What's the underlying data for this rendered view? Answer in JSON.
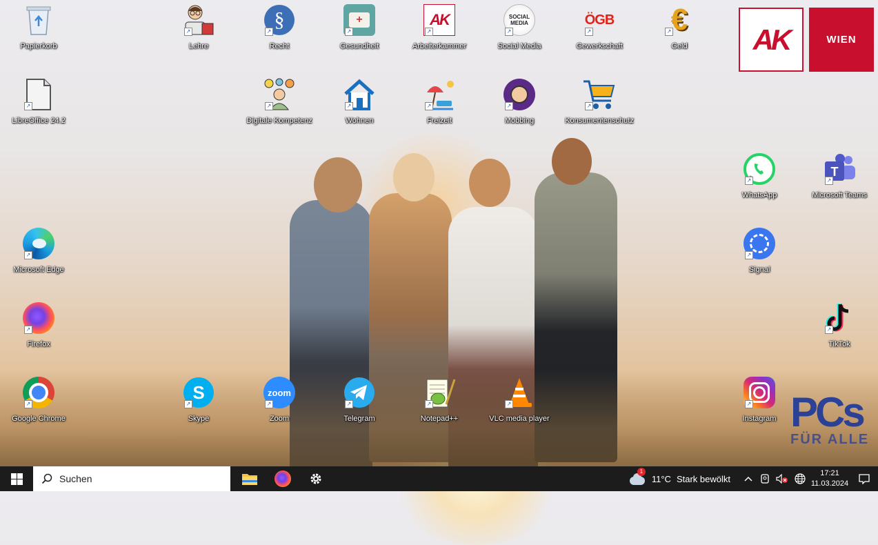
{
  "desktop": {
    "icons": [
      {
        "name": "recycle-bin",
        "label": "Papierkorb",
        "glyph": "recycle-bin-icon"
      },
      {
        "name": "lehre",
        "label": "Lehre",
        "glyph": "teacher-icon"
      },
      {
        "name": "recht",
        "label": "Recht",
        "glyph": "paragraph-icon"
      },
      {
        "name": "gesundheit",
        "label": "Gesundheit",
        "glyph": "first-aid-icon"
      },
      {
        "name": "arbeiterkammer",
        "label": "Arbeiterkammer",
        "glyph": "ak-icon"
      },
      {
        "name": "social-media",
        "label": "Social Media",
        "glyph": "social-media-icon"
      },
      {
        "name": "gewerkschaft",
        "label": "Gewerkschaft",
        "glyph": "ogb-icon"
      },
      {
        "name": "geld",
        "label": "Geld",
        "glyph": "euro-icon"
      },
      {
        "name": "libreoffice",
        "label": "LibreOffice 24.2",
        "glyph": "document-icon"
      },
      {
        "name": "digitale-kompetenz",
        "label": "Digitale Kompetenz",
        "glyph": "ideas-icon"
      },
      {
        "name": "wohnen",
        "label": "Wohnen",
        "glyph": "house-icon"
      },
      {
        "name": "freizeit",
        "label": "Freizeit",
        "glyph": "beach-icon"
      },
      {
        "name": "mobbing",
        "label": "Mobbing",
        "glyph": "mobbing-icon"
      },
      {
        "name": "konsumentenschutz",
        "label": "Konsumentenschutz",
        "glyph": "cart-icon"
      },
      {
        "name": "whatsapp",
        "label": "WhatsApp",
        "glyph": "whatsapp-icon"
      },
      {
        "name": "microsoft-teams",
        "label": "Microsoft Teams",
        "glyph": "teams-icon"
      },
      {
        "name": "microsoft-edge",
        "label": "Microsoft Edge",
        "glyph": "edge-icon"
      },
      {
        "name": "signal",
        "label": "Signal",
        "glyph": "signal-icon"
      },
      {
        "name": "firefox",
        "label": "Firefox",
        "glyph": "firefox-icon"
      },
      {
        "name": "tiktok",
        "label": "TikTok",
        "glyph": "tiktok-icon"
      },
      {
        "name": "google-chrome",
        "label": "Google Chrome",
        "glyph": "chrome-icon"
      },
      {
        "name": "skype",
        "label": "Skype",
        "glyph": "skype-icon"
      },
      {
        "name": "zoom",
        "label": "Zoom",
        "glyph": "zoom-icon"
      },
      {
        "name": "telegram",
        "label": "Telegram",
        "glyph": "telegram-icon"
      },
      {
        "name": "notepad-plus-plus",
        "label": "Notepad++",
        "glyph": "notepad-icon"
      },
      {
        "name": "vlc",
        "label": "VLC media player",
        "glyph": "vlc-icon"
      },
      {
        "name": "instagram",
        "label": "Instagram",
        "glyph": "instagram-icon"
      }
    ],
    "icon_text": {
      "ak": "AK",
      "ogb": "ÖGB",
      "euro": "€",
      "paragraph": "§",
      "zoom": "zoom",
      "skype": "S",
      "social": "SOCIAL MEDIA"
    },
    "logos": {
      "ak": "AK",
      "wien": "WIEN",
      "pcs": "PCs",
      "pcs_sub": "FÜR ALLE"
    }
  },
  "taskbar": {
    "search_placeholder": "Suchen",
    "pinned": [
      "file-explorer",
      "firefox",
      "settings"
    ],
    "weather_temp": "11°C",
    "weather_text": "Stark bewölkt",
    "weather_badge": "1",
    "time": "17:21",
    "date": "11.03.2024"
  },
  "colors": {
    "taskbar_bg": "#1c1c1c",
    "ak_red": "#c8102e",
    "pcs_blue": "#1f3a9a"
  }
}
